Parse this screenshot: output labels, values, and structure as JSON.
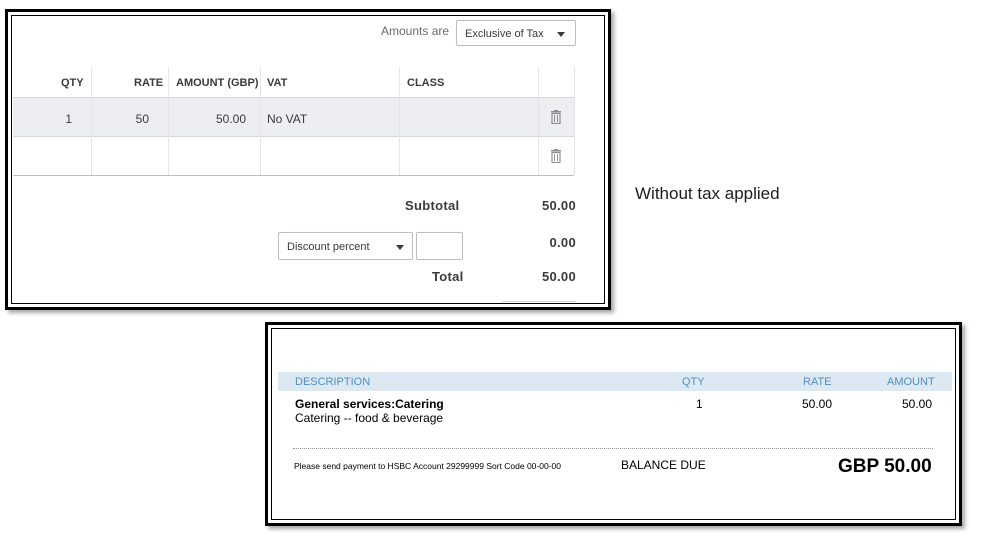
{
  "editor": {
    "amounts_label": "Amounts are",
    "amounts_value": "Exclusive of Tax",
    "columns": {
      "qty": "QTY",
      "rate": "RATE",
      "amount": "AMOUNT (GBP)",
      "vat": "VAT",
      "class": "CLASS"
    },
    "rows": [
      {
        "qty": "1",
        "rate": "50",
        "amount": "50.00",
        "vat": "No VAT",
        "class": ""
      },
      {
        "qty": "",
        "rate": "",
        "amount": "",
        "vat": "",
        "class": ""
      }
    ],
    "subtotal_label": "Subtotal",
    "subtotal_value": "50.00",
    "discount_type": "Discount percent",
    "discount_value": "0.00",
    "total_label": "Total",
    "total_value": "50.00"
  },
  "note": "Without tax applied",
  "invoice": {
    "columns": {
      "description": "DESCRIPTION",
      "qty": "QTY",
      "rate": "RATE",
      "amount": "AMOUNT"
    },
    "item": {
      "name": "General services:Catering",
      "detail": "Catering -- food & beverage",
      "qty": "1",
      "rate": "50.00",
      "amount": "50.00"
    },
    "payment_note": "Please send payment to HSBC Account 29299999 Sort Code 00-00-00",
    "balance_label": "BALANCE DUE",
    "balance_value": "GBP 50.00"
  },
  "icons": {
    "delete": "trash-icon",
    "dropdown": "caret-down-icon"
  },
  "colors": {
    "header_band": "#dce8f2",
    "header_text": "#4f8fc7",
    "row_highlight": "#eceef1"
  }
}
